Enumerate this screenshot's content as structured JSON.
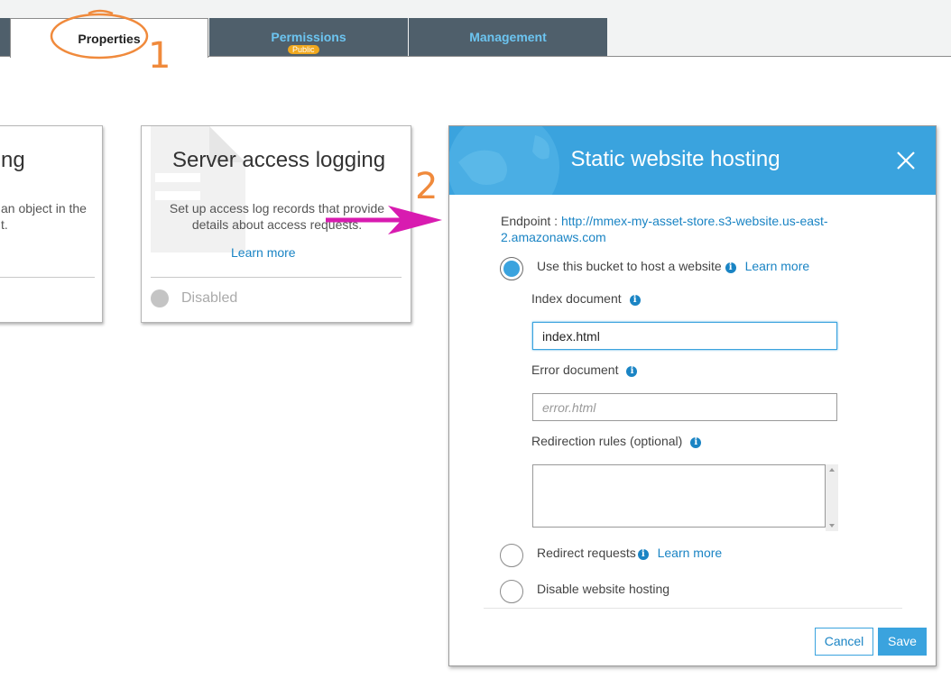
{
  "tabs": [
    {
      "label": "Properties",
      "active": true
    },
    {
      "label": "Permissions",
      "badge": "Public"
    },
    {
      "label": "Management"
    }
  ],
  "cards": {
    "left": {
      "title_fragment": "ng",
      "desc_line1": "an object in the",
      "desc_line2": "t."
    },
    "logging": {
      "title": "Server access logging",
      "desc_line1": "Set up access log records that provide",
      "desc_line2": "details about access requests.",
      "learn_more": "Learn more",
      "status": "Disabled"
    }
  },
  "modal": {
    "title": "Static website hosting",
    "endpoint_label": "Endpoint :",
    "endpoint_url_line1": "http://mmex-my-asset-store.s3-website.us-east-",
    "endpoint_url_line2": "2.amazonaws.com",
    "options": {
      "host": {
        "label": "Use this bucket to host a website",
        "learn_more": "Learn more",
        "selected": true
      },
      "redirect": {
        "label": "Redirect requests",
        "learn_more": "Learn more",
        "selected": false
      },
      "disable": {
        "label": "Disable website hosting",
        "selected": false
      }
    },
    "index_document": {
      "label": "Index document",
      "value": "index.html"
    },
    "error_document": {
      "label": "Error document",
      "placeholder": "error.html"
    },
    "redirection_rules": {
      "label": "Redirection rules (optional)"
    },
    "cancel": "Cancel",
    "save": "Save"
  },
  "annotations": {
    "step1": "1",
    "step2": "2"
  },
  "colors": {
    "accent": "#3aa3de",
    "link": "#1a84c4",
    "tab_bg": "#4f5f6b",
    "tab_text": "#6cc4f0",
    "annotation_orange": "#f08a3c",
    "annotation_arrow": "#d81bb0",
    "badge": "#f0a81e"
  }
}
